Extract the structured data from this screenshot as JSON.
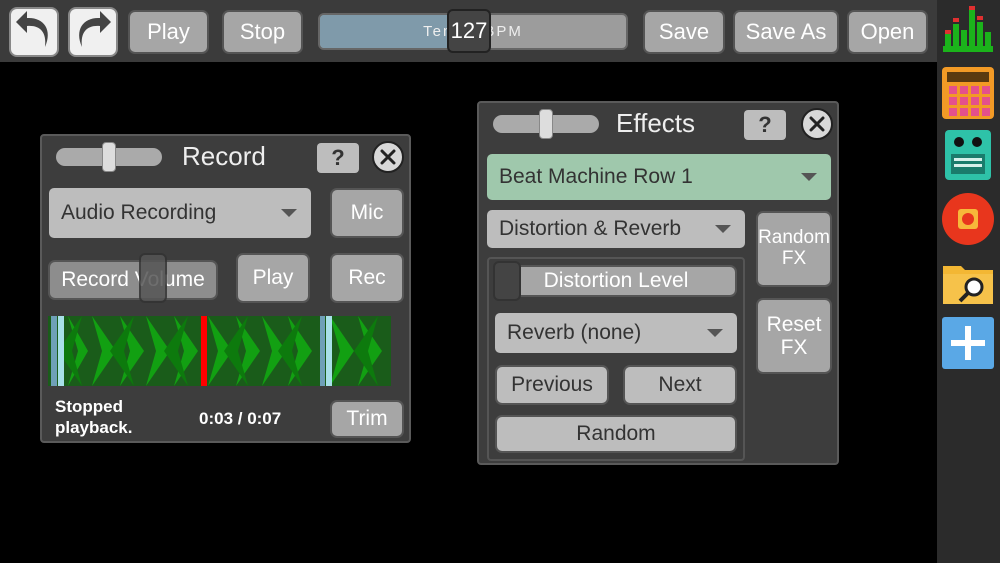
{
  "toolbar": {
    "undo_icon": "undo-arrow-icon",
    "redo_icon": "redo-arrow-icon",
    "play_label": "Play",
    "stop_label": "Stop",
    "tempo_label": "Tempo BPM",
    "tempo_value": "127",
    "save_label": "Save",
    "save_as_label": "Save As",
    "open_label": "Open"
  },
  "sidebar": {
    "icons": [
      "equalizer-icon",
      "beat-pad-icon",
      "synth-keyboard-icon",
      "record-icon",
      "folder-search-icon",
      "add-module-icon"
    ]
  },
  "record_panel": {
    "title": "Record",
    "help_label": "?",
    "source_select": "Audio Recording",
    "mic_label": "Mic",
    "volume_label": "Record Volume",
    "play_label": "Play",
    "rec_label": "Rec",
    "status": "Stopped playback.",
    "time": "0:03 / 0:07",
    "trim_label": "Trim"
  },
  "effects_panel": {
    "title": "Effects",
    "help_label": "?",
    "target_select": "Beat Machine Row 1",
    "preset_select": "Distortion & Reverb",
    "distortion_label": "Distortion Level",
    "reverb_select": "Reverb (none)",
    "previous_label": "Previous",
    "next_label": "Next",
    "random_label": "Random",
    "random_fx_label": "Random FX",
    "reset_fx_label": "Reset FX"
  },
  "colors": {
    "toolbar_bg": "#3b3b3b",
    "button_gray": "#a6a6a6",
    "panel_bg": "#3d3d3d",
    "target_green": "#9fc8ac",
    "wave_green": "#1f8f1f",
    "playhead_red": "#ff0000"
  }
}
